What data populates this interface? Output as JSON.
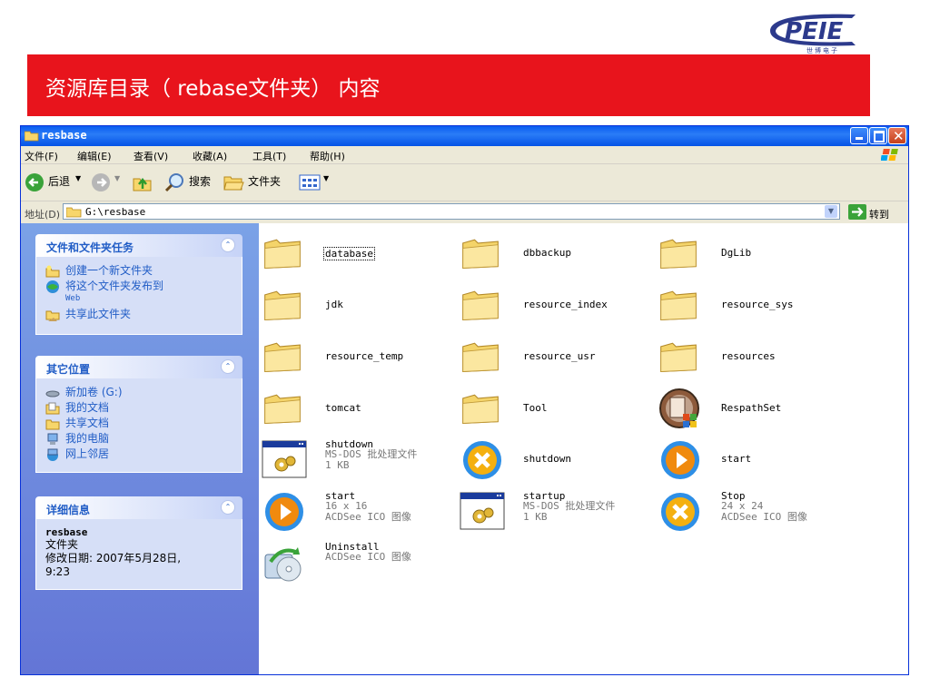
{
  "slide": {
    "logo_text": "PEIE",
    "logo_sub": "世博电子",
    "title": "资源库目录（ rebase文件夹） 内容"
  },
  "window": {
    "title": "resbase",
    "menu": [
      "文件(F)",
      "编辑(E)",
      "查看(V)",
      "收藏(A)",
      "工具(T)",
      "帮助(H)"
    ],
    "toolbar": {
      "back": "后退",
      "search": "搜索",
      "folders": "文件夹"
    },
    "address": {
      "label": "地址(D)",
      "path": "G:\\resbase",
      "go": "转到"
    }
  },
  "sidebar": {
    "tasks": {
      "title": "文件和文件夹任务",
      "items": [
        {
          "label": "创建一个新文件夹",
          "icon": "new-folder-icon"
        },
        {
          "label": "将这个文件夹发布到",
          "sub": "Web",
          "icon": "publish-web-icon"
        },
        {
          "label": "共享此文件夹",
          "icon": "share-folder-icon"
        }
      ]
    },
    "places": {
      "title": "其它位置",
      "items": [
        {
          "label": "新加卷 (G:)",
          "icon": "drive-icon"
        },
        {
          "label": "我的文档",
          "icon": "my-documents-icon"
        },
        {
          "label": "共享文档",
          "icon": "shared-documents-icon"
        },
        {
          "label": "我的电脑",
          "icon": "my-computer-icon"
        },
        {
          "label": "网上邻居",
          "icon": "network-icon"
        }
      ]
    },
    "details": {
      "title": "详细信息",
      "name": "resbase",
      "type": "文件夹",
      "modified": "修改日期: 2007年5月28日,",
      "time": "9:23"
    }
  },
  "files": [
    {
      "name": "database",
      "kind": "folder",
      "selected": true
    },
    {
      "name": "dbbackup",
      "kind": "folder"
    },
    {
      "name": "DgLib",
      "kind": "folder"
    },
    {
      "name": "jdk",
      "kind": "folder"
    },
    {
      "name": "resource_index",
      "kind": "folder"
    },
    {
      "name": "resource_sys",
      "kind": "folder"
    },
    {
      "name": "resource_temp",
      "kind": "folder"
    },
    {
      "name": "resource_usr",
      "kind": "folder"
    },
    {
      "name": "resources",
      "kind": "folder"
    },
    {
      "name": "tomcat",
      "kind": "folder"
    },
    {
      "name": "Tool",
      "kind": "folder"
    },
    {
      "name": "RespathSet",
      "kind": "app"
    },
    {
      "name": "shutdown",
      "kind": "batch",
      "meta": [
        "MS-DOS 批处理文件",
        "1 KB"
      ]
    },
    {
      "name": "shutdown",
      "kind": "stop"
    },
    {
      "name": "start",
      "kind": "play"
    },
    {
      "name": "start",
      "kind": "play",
      "meta": [
        "16 x 16",
        "ACDSee ICO 图像"
      ]
    },
    {
      "name": "startup",
      "kind": "batch",
      "meta": [
        "MS-DOS 批处理文件",
        "1 KB"
      ]
    },
    {
      "name": "Stop",
      "kind": "stop",
      "meta": [
        "24 x 24",
        "ACDSee ICO 图像"
      ]
    },
    {
      "name": "Uninstall",
      "kind": "uninstall",
      "meta": [
        "ACDSee ICO 图像"
      ]
    }
  ]
}
